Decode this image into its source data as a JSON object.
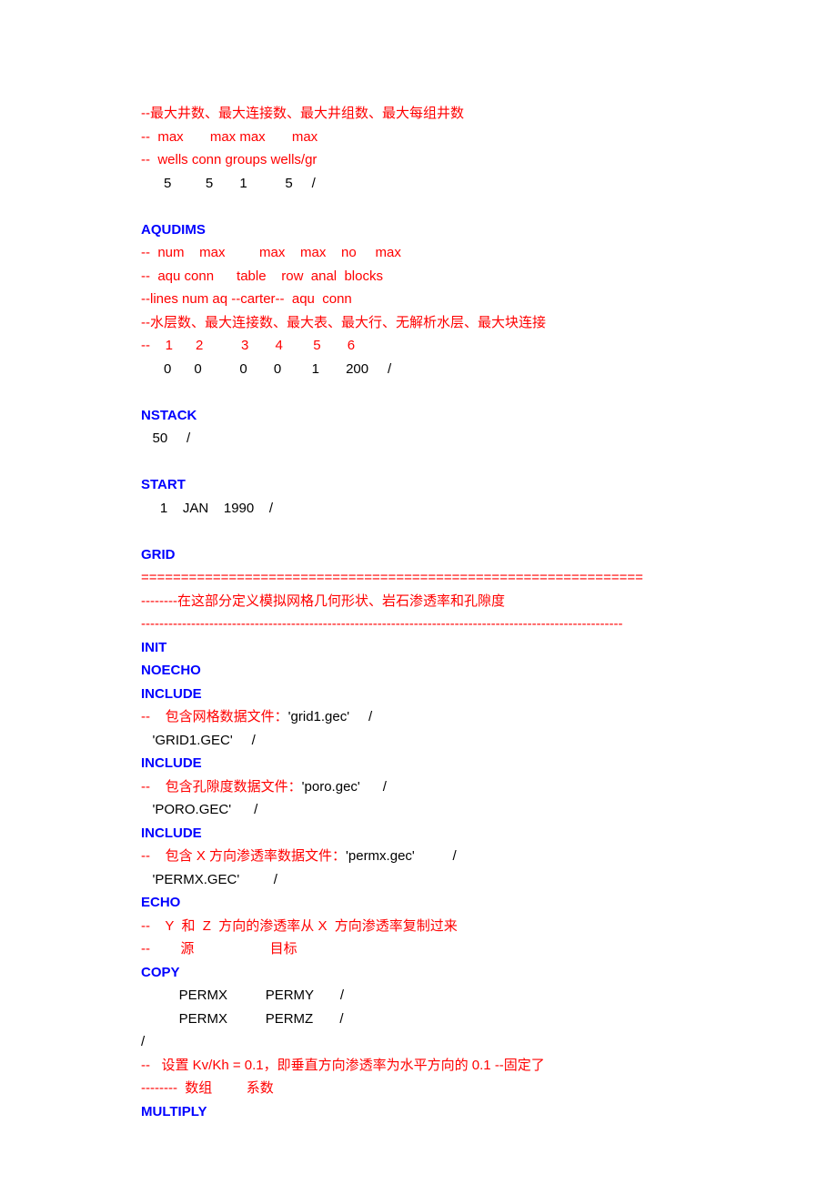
{
  "l01": "--最大井数、最大连接数、最大井组数、最大每组井数",
  "l02": "--  max       max max       max",
  "l03": "--  wells conn groups wells/gr",
  "l04": "      5         5       1          5     /",
  "l05": "AQUDIMS",
  "l06": "--  num    max         max    max    no     max",
  "l07": "--  aqu conn      table    row  anal  blocks",
  "l08": "--lines num aq --carter--  aqu  conn",
  "l09": "--水层数、最大连接数、最大表、最大行、无解析水层、最大块连接",
  "l10": "--    1      2          3       4        5       6",
  "l11": "      0      0          0       0        1       200     /",
  "l12": "NSTACK",
  "l13": "   50     /",
  "l14": "START",
  "l15": "     1    JAN    1990    /",
  "l16": "GRID",
  "l17": "===============================================================",
  "l18": "--------在这部分定义模拟网格几何形状、岩石渗透率和孔隙度",
  "l19": "----------------------------------------------------------------------------------------------------------",
  "l20": "INIT",
  "l21": "NOECHO",
  "l22": "INCLUDE",
  "l23a": "--    包含网格数据文件：",
  "l23b": "'grid1.gec'     /",
  "l24": "   'GRID1.GEC'     /",
  "l25": "INCLUDE",
  "l26a": "--    包含孔隙度数据文件：",
  "l26b": "'poro.gec'      /",
  "l27": "   'PORO.GEC'      /",
  "l28": "INCLUDE",
  "l29a": "--    包含 X 方向渗透率数据文件：",
  "l29b": "'permx.gec'          /",
  "l30": "   'PERMX.GEC'         /",
  "l31": "ECHO",
  "l32": "--    Y  和  Z  方向的渗透率从 X  方向渗透率复制过来",
  "l33": "--        源                    目标",
  "l34": "COPY",
  "l35": "          PERMX          PERMY       /",
  "l36": "          PERMX          PERMZ       /",
  "l37": "/",
  "l38": "--   设置 Kv/Kh = 0.1，即垂直方向渗透率为水平方向的 0.1 --固定了",
  "l39": "--------  数组         系数",
  "l40": "MULTIPLY"
}
